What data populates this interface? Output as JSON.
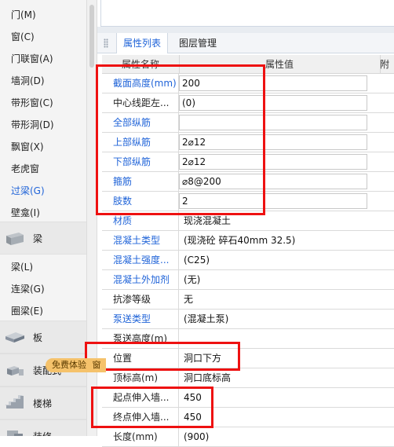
{
  "sidebar": {
    "items_top": [
      {
        "label": "门(M)",
        "active": false
      },
      {
        "label": "窗(C)",
        "active": false
      },
      {
        "label": "门联窗(A)",
        "active": false
      },
      {
        "label": "墙洞(D)",
        "active": false
      },
      {
        "label": "带形窗(C)",
        "active": false
      },
      {
        "label": "带形洞(D)",
        "active": false
      },
      {
        "label": "飘窗(X)",
        "active": false
      },
      {
        "label": "老虎窗",
        "active": false
      },
      {
        "label": "过梁(G)",
        "active": true
      },
      {
        "label": "壁龛(I)",
        "active": false
      }
    ],
    "category_beam": "梁",
    "items_beam": [
      {
        "label": "梁(L)"
      },
      {
        "label": "连梁(G)"
      },
      {
        "label": "圈梁(E)"
      }
    ],
    "category_slab": "板",
    "category_assembly": "装配式",
    "category_stair": "楼梯",
    "category_bottom": "装修",
    "free_badge": "免费体验",
    "free_badge_suffix": "窗"
  },
  "tabs": {
    "properties": "属性列表",
    "layers": "图层管理"
  },
  "table": {
    "header_name": "属性名称",
    "header_value": "属性值",
    "header_extra": "附",
    "rows": [
      {
        "name": "截面高度(mm)",
        "value": "200",
        "name_color": "blue",
        "boxed": true
      },
      {
        "name": "中心线距左...",
        "value": "(0)",
        "name_color": "black",
        "boxed": true
      },
      {
        "name": "全部纵筋",
        "value": "",
        "name_color": "blue",
        "boxed": true
      },
      {
        "name": "上部纵筋",
        "value": "2⌀12",
        "name_color": "blue",
        "boxed": true
      },
      {
        "name": "下部纵筋",
        "value": "2⌀12",
        "name_color": "blue",
        "boxed": true
      },
      {
        "name": "箍筋",
        "value": "⌀8@200",
        "name_color": "blue",
        "boxed": true
      },
      {
        "name": "肢数",
        "value": "2",
        "name_color": "blue",
        "boxed": true
      },
      {
        "name": "材质",
        "value": "现浇混凝土",
        "name_color": "blue",
        "boxed": false
      },
      {
        "name": "混凝土类型",
        "value": "(现浇砼 碎石40mm 32.5)",
        "name_color": "blue",
        "boxed": false
      },
      {
        "name": "混凝土强度...",
        "value": "(C25)",
        "name_color": "blue",
        "boxed": false
      },
      {
        "name": "混凝土外加剂",
        "value": "(无)",
        "name_color": "blue",
        "boxed": false
      },
      {
        "name": "抗渗等级",
        "value": "无",
        "name_color": "black",
        "boxed": false
      },
      {
        "name": "泵送类型",
        "value": "(混凝土泵)",
        "name_color": "blue",
        "boxed": false
      },
      {
        "name": "泵送高度(m)",
        "value": "",
        "name_color": "black",
        "boxed": false
      },
      {
        "name": "位置",
        "value": "洞口下方",
        "name_color": "black",
        "boxed": false
      },
      {
        "name": "顶标高(m)",
        "value": "洞口底标高",
        "name_color": "black",
        "boxed": false
      },
      {
        "name": "起点伸入墙...",
        "value": "450",
        "name_color": "black",
        "boxed": false
      },
      {
        "name": "终点伸入墙...",
        "value": "450",
        "name_color": "black",
        "boxed": false
      },
      {
        "name": "长度(mm)",
        "value": "(900)",
        "name_color": "black",
        "boxed": false
      }
    ]
  },
  "colors": {
    "accent_blue": "#1f63d8",
    "highlight_red": "#ee1111",
    "badge_orange": "#f5c26b"
  }
}
